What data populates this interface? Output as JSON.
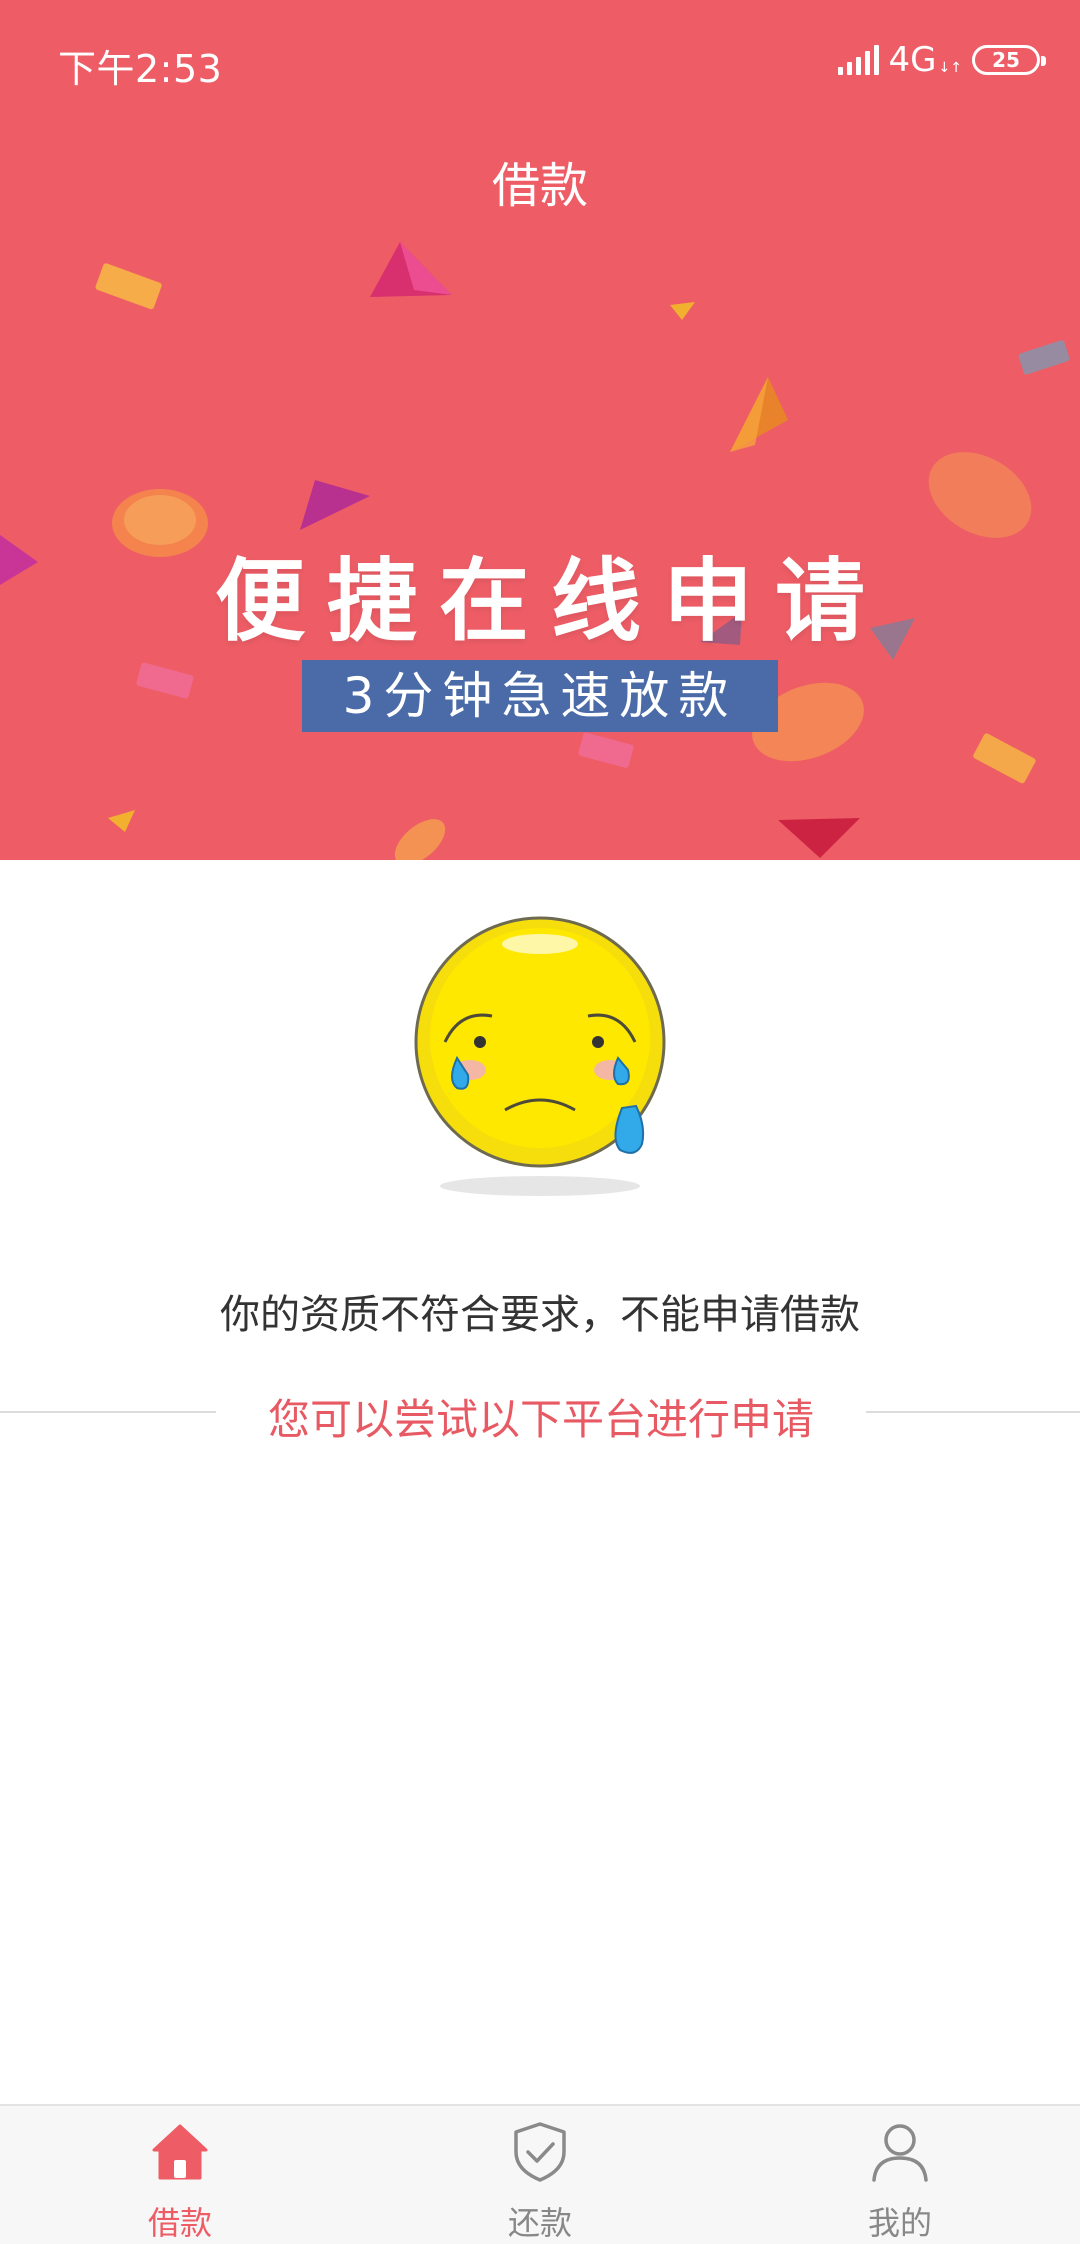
{
  "status_bar": {
    "time": "下午2:53",
    "network": "4G",
    "network_sub": "↓↑",
    "battery": "25"
  },
  "header": {
    "title": "借款"
  },
  "banner": {
    "title": "便捷在线申请",
    "subtitle": "3分钟急速放款"
  },
  "message": {
    "main": "你的资质不符合要求，不能申请借款",
    "sub": "您可以尝试以下平台进行申请"
  },
  "tabs": [
    {
      "label": "借款",
      "icon": "home-icon",
      "active": true
    },
    {
      "label": "还款",
      "icon": "shield-check-icon",
      "active": false
    },
    {
      "label": "我的",
      "icon": "user-icon",
      "active": false
    }
  ],
  "colors": {
    "accent": "#ee5d66",
    "banner_sub_bg": "#4a6ba7",
    "text": "#333333",
    "inactive": "#888888"
  }
}
